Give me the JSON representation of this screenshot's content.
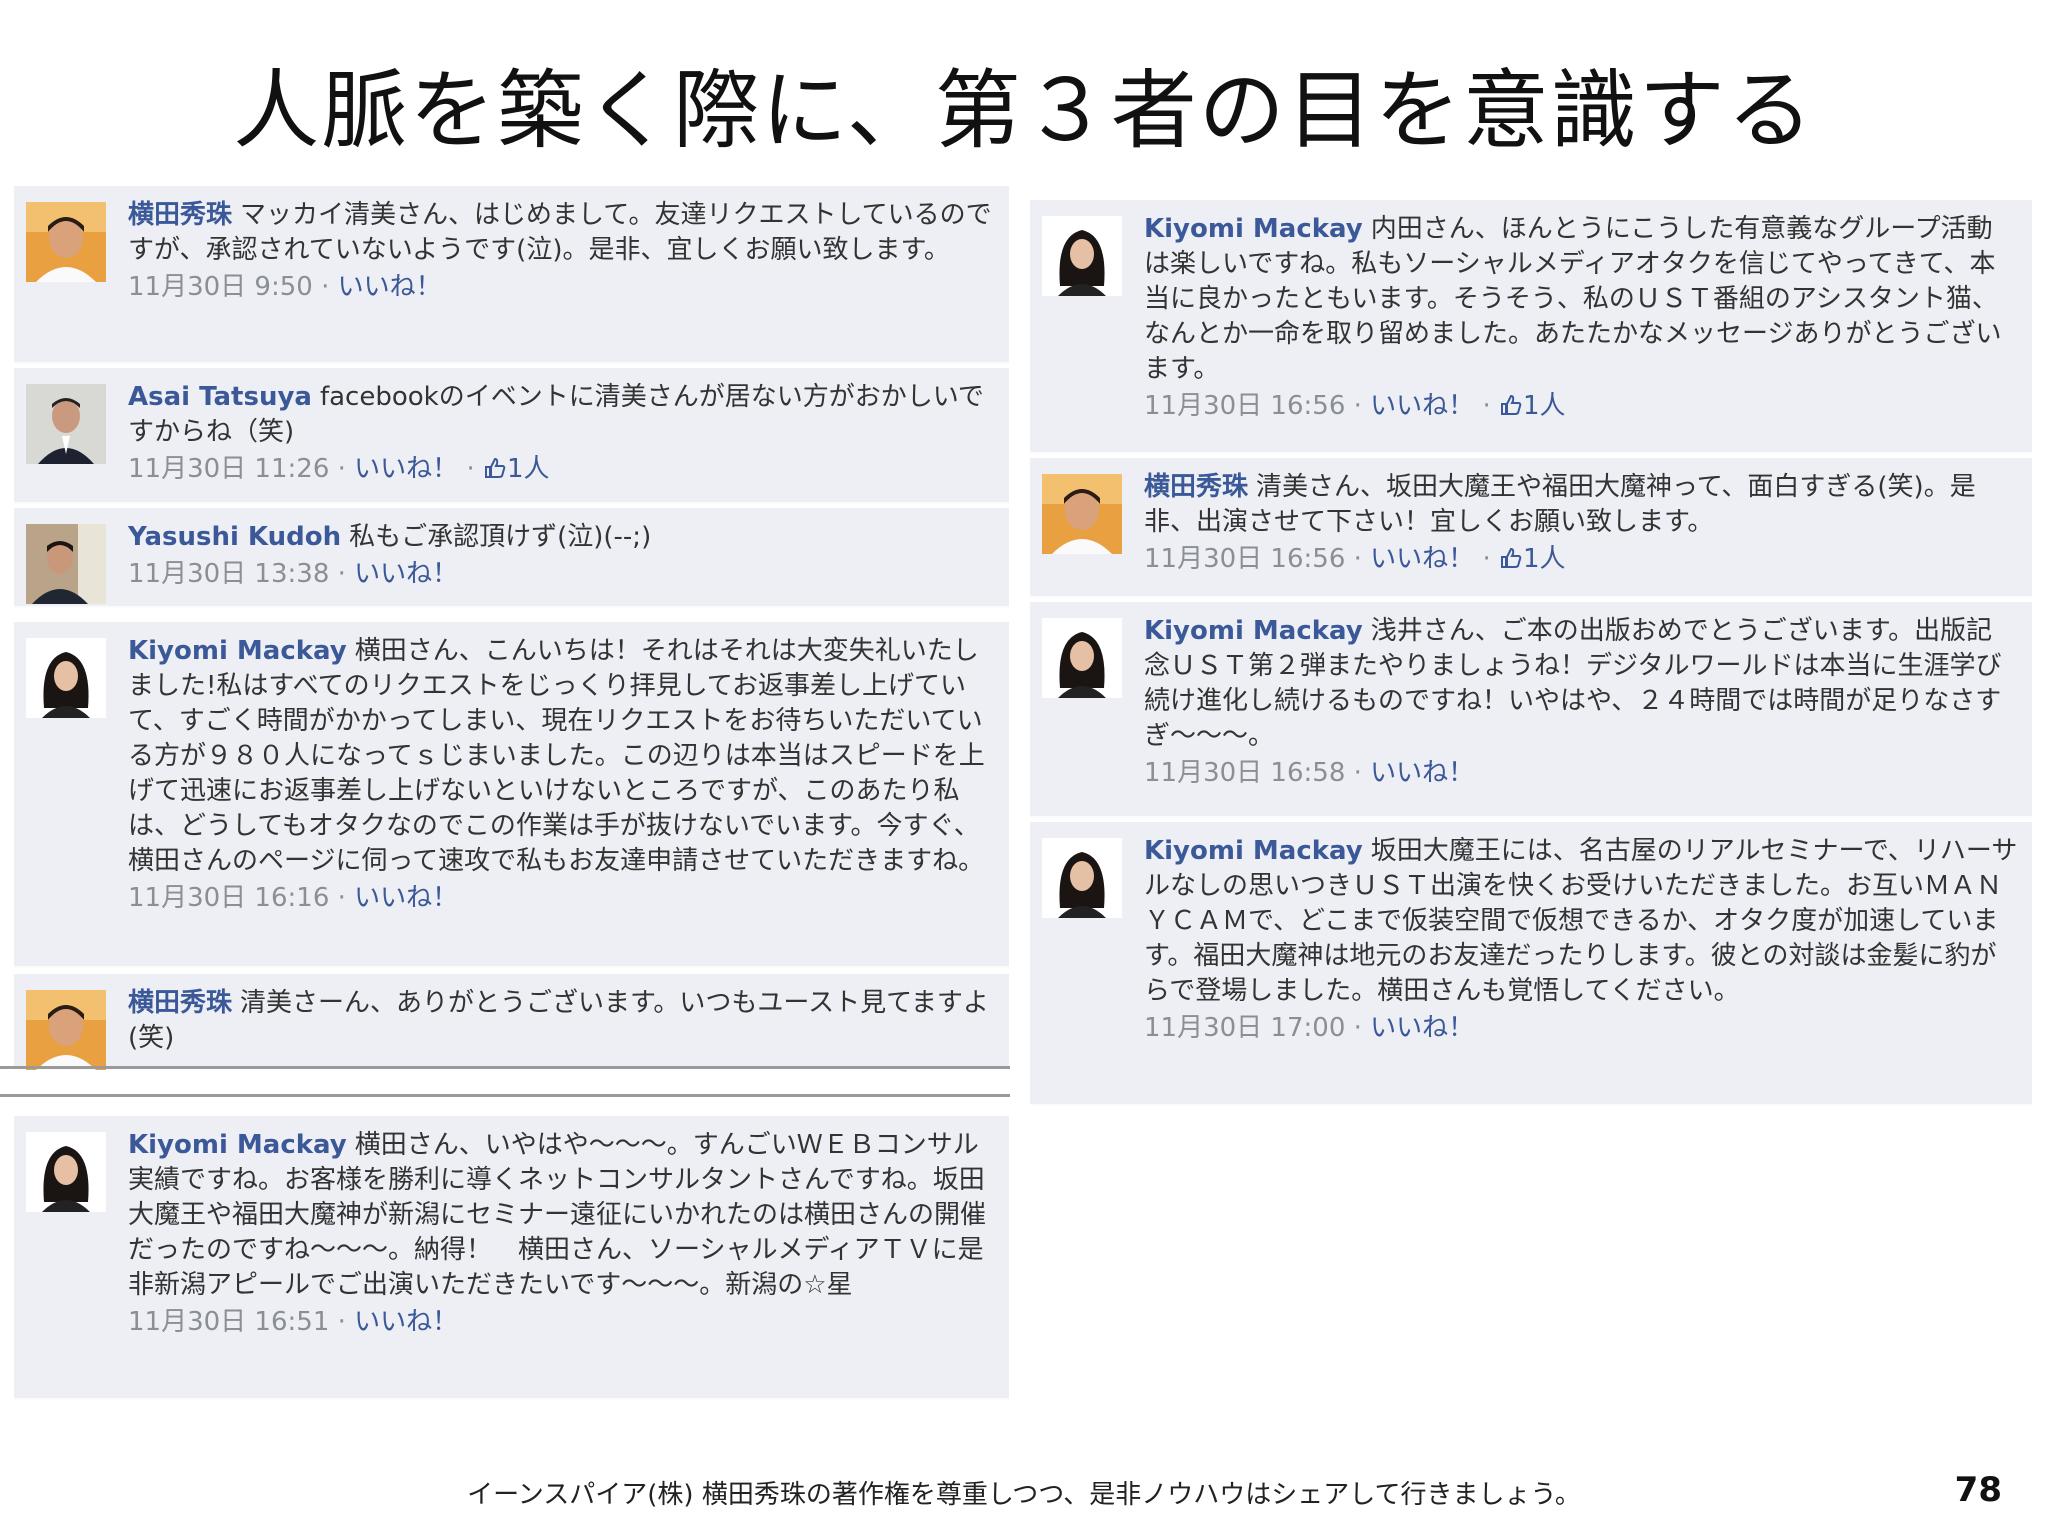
{
  "title": "人脈を築く際に、第３者の目を意識する",
  "footer": "イーンスパイア(株) 横田秀珠の著作権を尊重しつつ、是非ノウハウはシェアして行きましょう。",
  "page_number": "78",
  "left_comments": [
    {
      "author": "横田秀珠",
      "avatar": "man-orange-bg",
      "text": "マッカイ清美さん、はじめまして。友達リクエストしているのですが、承認されていないようです(泣)。是非、宜しくお願い致します。",
      "time": "11月30日 9:50",
      "like": "いいね！",
      "likes": ""
    },
    {
      "author": "Asai Tatsuya",
      "avatar": "man-suit",
      "text": "facebookのイベントに清美さんが居ない方がおかしいですからね（笑)",
      "time": "11月30日 11:26",
      "like": "いいね！",
      "likes": "1人"
    },
    {
      "author": "Yasushi Kudoh",
      "avatar": "man-window",
      "text": "私もご承認頂けず(泣)(--;)",
      "time": "11月30日 13:38",
      "like": "いいね！",
      "likes": ""
    },
    {
      "author": "Kiyomi Mackay",
      "avatar": "woman-dark-hair",
      "text": "横田さん、こんいちは！それはそれは大変失礼いたしました!私はすべてのリクエストをじっくり拝見してお返事差し上げていて、すごく時間がかかってしまい、現在リクエストをお待ちいただいている方が９８０人になってｓじまいました。この辺りは本当はスピードを上げて迅速にお返事差し上げないといけないところですが、このあたり私は、どうしてもオタクなのでこの作業は手が抜けないでいます。今すぐ、横田さんのページに伺って速攻で私もお友達申請させていただきますね。",
      "time": "11月30日 16:16",
      "like": "いいね！",
      "likes": ""
    },
    {
      "author": "横田秀珠",
      "avatar": "man-orange-bg",
      "text": "清美さーん、ありがとうございます。いつもユースト見てますよ(笑)",
      "time": "",
      "like": "",
      "likes": ""
    },
    {
      "author": "Kiyomi Mackay",
      "avatar": "woman-dark-hair",
      "text": "横田さん、いやはや〜〜〜。すんごいＷＥＢコンサル実績ですね。お客様を勝利に導くネットコンサルタントさんですね。坂田大魔王や福田大魔神が新潟にセミナー遠征にいかれたのは横田さんの開催だったのですね〜〜〜。納得！　横田さん、ソーシャルメディアＴＶに是非新潟アピールでご出演いただきたいです〜〜〜。新潟の☆星",
      "time": "11月30日 16:51",
      "like": "いいね！",
      "likes": ""
    }
  ],
  "right_comments": [
    {
      "author": "Kiyomi Mackay",
      "avatar": "woman-dark-hair",
      "text": "内田さん、ほんとうにこうした有意義なグループ活動は楽しいですね。私もソーシャルメディアオタクを信じてやってきて、本当に良かったともいます。そうそう、私のＵＳＴ番組のアシスタント猫、なんとか一命を取り留めました。あたたかなメッセージありがとうございます。",
      "time": "11月30日 16:56",
      "like": "いいね！",
      "likes": "1人"
    },
    {
      "author": "横田秀珠",
      "avatar": "man-orange-bg",
      "text": "清美さん、坂田大魔王や福田大魔神って、面白すぎる(笑)。是非、出演させて下さい！宜しくお願い致します。",
      "time": "11月30日 16:56",
      "like": "いいね！",
      "likes": "1人"
    },
    {
      "author": "Kiyomi Mackay",
      "avatar": "woman-dark-hair",
      "text": "浅井さん、ご本の出版おめでとうございます。出版記念ＵＳＴ第２弾またやりましょうね！デジタルワールドは本当に生涯学び続け進化し続けるものですね！いやはや、２４時間では時間が足りなさすぎ〜〜〜。",
      "time": "11月30日 16:58",
      "like": "いいね！",
      "likes": ""
    },
    {
      "author": "Kiyomi Mackay",
      "avatar": "woman-dark-hair",
      "text": "坂田大魔王には、名古屋のリアルセミナーで、リハーサルなしの思いつきＵＳＴ出演を快くお受けいただきました。お互いＭＡＮＹＣＡＭで、どこまで仮装空間で仮想できるか、オタク度が加速しています。福田大魔神は地元のお友達だったりします。彼との対談は金髪に豹がらで登場しました。横田さんも覚悟してください。",
      "time": "11月30日 17:00",
      "like": "いいね！",
      "likes": ""
    }
  ],
  "ui": {
    "separator": " · ",
    "author_color": "#3b5998",
    "panel_bg": "#edeff4"
  }
}
